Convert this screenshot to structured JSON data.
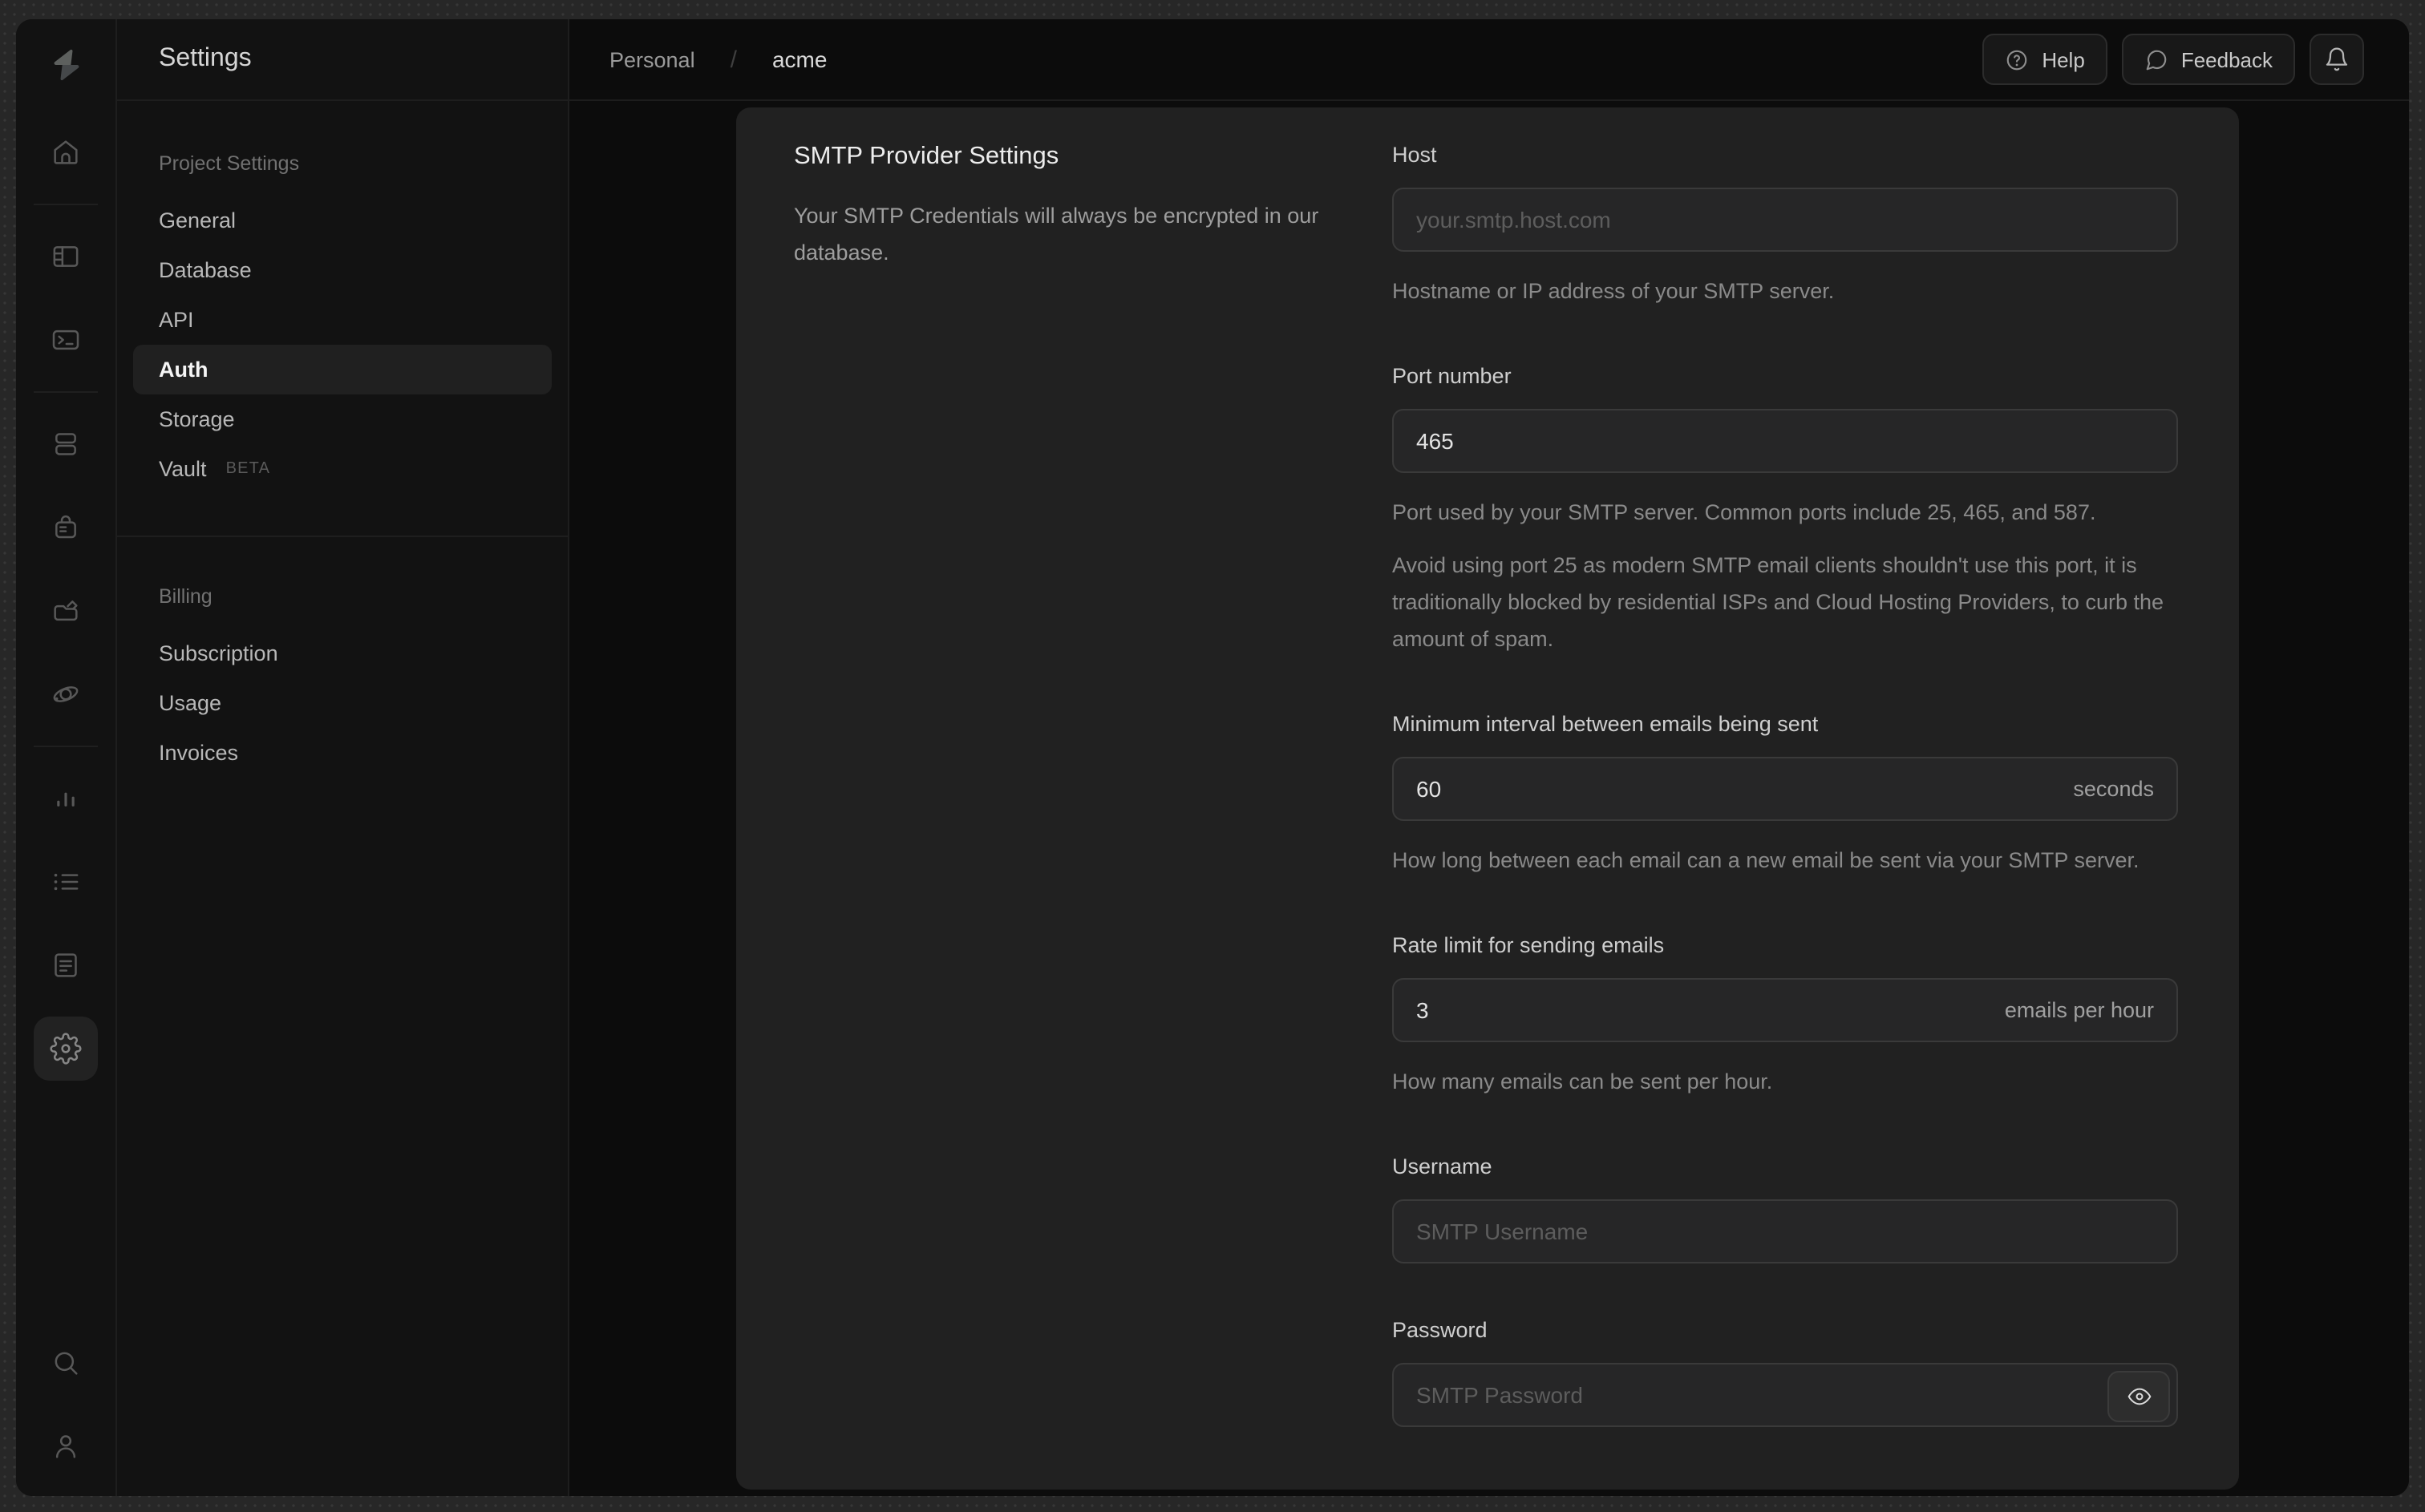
{
  "chrome": {
    "backdrop_color": "#272727",
    "window_bg": "#0d0d0d",
    "card_bg": "#212121"
  },
  "sidebar_rail": {
    "logo_icon": "supabase-logo",
    "items": [
      {
        "icon": "home-icon",
        "active": false
      },
      {
        "icon": "table-editor-icon",
        "active": false
      },
      {
        "icon": "sql-editor-icon",
        "active": false
      },
      {
        "icon": "database-icon",
        "active": false
      },
      {
        "icon": "auth-icon",
        "active": false
      },
      {
        "icon": "storage-icon",
        "active": false
      },
      {
        "icon": "edge-functions-icon",
        "active": false
      },
      {
        "icon": "reports-icon",
        "active": false
      },
      {
        "icon": "logs-icon",
        "active": false
      },
      {
        "icon": "docs-icon",
        "active": false
      },
      {
        "icon": "settings-gear-icon",
        "active": true
      },
      {
        "icon": "search-icon",
        "active": false
      },
      {
        "icon": "user-icon",
        "active": false
      }
    ]
  },
  "settings_nav": {
    "title": "Settings",
    "sections": [
      {
        "header": "Project Settings",
        "items": [
          {
            "label": "General",
            "active": false
          },
          {
            "label": "Database",
            "active": false
          },
          {
            "label": "API",
            "active": false
          },
          {
            "label": "Auth",
            "active": true
          },
          {
            "label": "Storage",
            "active": false
          },
          {
            "label": "Vault",
            "active": false,
            "badge": "BETA"
          }
        ]
      },
      {
        "header": "Billing",
        "items": [
          {
            "label": "Subscription",
            "active": false
          },
          {
            "label": "Usage",
            "active": false
          },
          {
            "label": "Invoices",
            "active": false
          }
        ]
      }
    ]
  },
  "header": {
    "breadcrumb": {
      "org": "Personal",
      "separator": "/",
      "project": "acme"
    },
    "actions": {
      "help_label": "Help",
      "help_icon": "question-circle-icon",
      "feedback_label": "Feedback",
      "feedback_icon": "speech-bubble-icon",
      "notifications_icon": "bell-icon"
    }
  },
  "panel": {
    "title": "SMTP Provider Settings",
    "description": "Your SMTP Credentials will always be encrypted in our database.",
    "fields": {
      "host": {
        "label": "Host",
        "placeholder": "your.smtp.host.com",
        "help": "Hostname or IP address of your SMTP server."
      },
      "port": {
        "label": "Port number",
        "value": "465",
        "help1": "Port used by your SMTP server. Common ports include 25, 465, and 587.",
        "help2": "Avoid using port 25 as modern SMTP email clients shouldn't use this port, it is traditionally blocked by residential ISPs and Cloud Hosting Providers, to curb the amount of spam."
      },
      "interval": {
        "label": "Minimum interval between emails being sent",
        "value": "60",
        "suffix": "seconds",
        "help": "How long between each email can a new email be sent via your SMTP server."
      },
      "rate_limit": {
        "label": "Rate limit for sending emails",
        "value": "3",
        "suffix": "emails per hour",
        "help": "How many emails can be sent per hour."
      },
      "username": {
        "label": "Username",
        "placeholder": "SMTP Username"
      },
      "password": {
        "label": "Password",
        "placeholder": "SMTP Password",
        "reveal_icon": "eye-icon"
      }
    }
  }
}
